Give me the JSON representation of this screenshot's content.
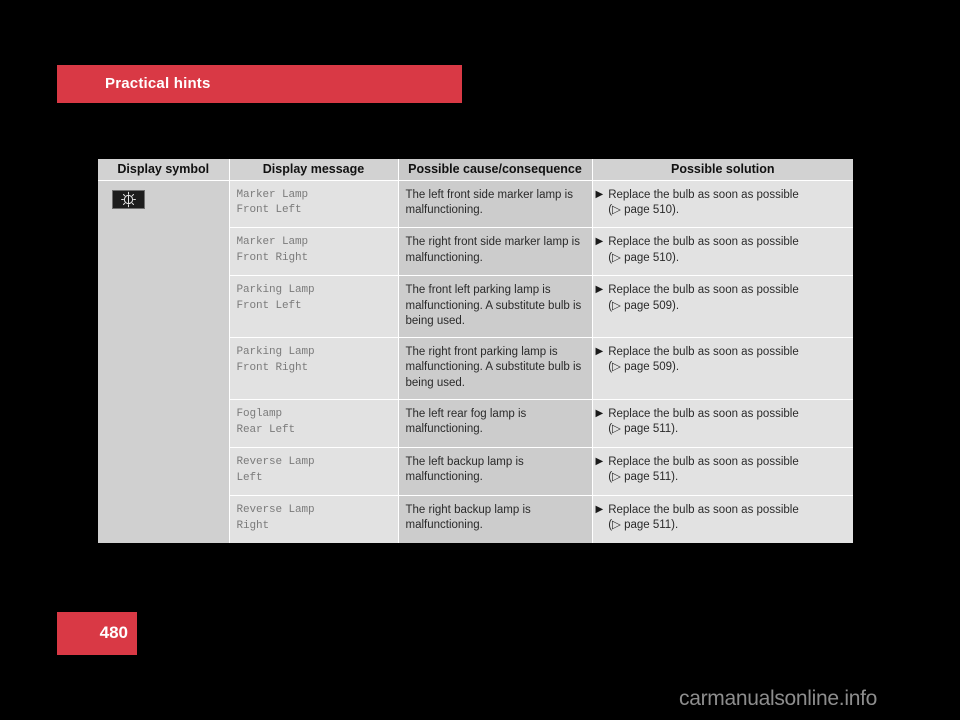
{
  "header": {
    "title": "Practical hints",
    "banner_color": "#d93945"
  },
  "table": {
    "columns": [
      "Display symbol",
      "Display message",
      "Possible cause/consequence",
      "Possible solution"
    ],
    "symbol": {
      "icon_name": "bulb-failure-icon",
      "background_color": "#1d1d1d"
    },
    "rows": [
      {
        "message": "Marker Lamp\nFront Left",
        "cause": "The left front side marker lamp is malfunctioning.",
        "solution": "Replace the bulb as soon as possible",
        "reference": "(▷ page 510).",
        "bullet": "▶"
      },
      {
        "message": "Marker Lamp\nFront Right",
        "cause": "The right front side marker lamp is malfunctioning.",
        "solution": "Replace the bulb as soon as possible",
        "reference": "(▷ page 510).",
        "bullet": "▶"
      },
      {
        "message": "Parking Lamp\nFront Left",
        "cause": "The front left parking lamp is malfunctioning. A substitute bulb is being used.",
        "solution": "Replace the bulb as soon as possible",
        "reference": "(▷ page 509).",
        "bullet": "▶"
      },
      {
        "message": "Parking Lamp\nFront Right",
        "cause": "The right front parking lamp is malfunctioning. A substitute bulb is being used.",
        "solution": "Replace the bulb as soon as possible",
        "reference": "(▷ page 509).",
        "bullet": "▶"
      },
      {
        "message": "Foglamp\nRear Left",
        "cause": "The left rear fog lamp is malfunctioning.",
        "solution": "Replace the bulb as soon as possible",
        "reference": "(▷ page 511).",
        "bullet": "▶"
      },
      {
        "message": "Reverse Lamp\nLeft",
        "cause": "The left backup lamp is malfunctioning.",
        "solution": "Replace the bulb as soon as possible",
        "reference": "(▷ page 511).",
        "bullet": "▶"
      },
      {
        "message": "Reverse Lamp\nRight",
        "cause": "The right backup lamp is malfunctioning.",
        "solution": "Replace the bulb as soon as possible",
        "reference": "(▷ page 511).",
        "bullet": "▶"
      }
    ]
  },
  "footer": {
    "page_number": "480",
    "page_block_color": "#d93945",
    "watermark": "carmanualsonline.info"
  }
}
